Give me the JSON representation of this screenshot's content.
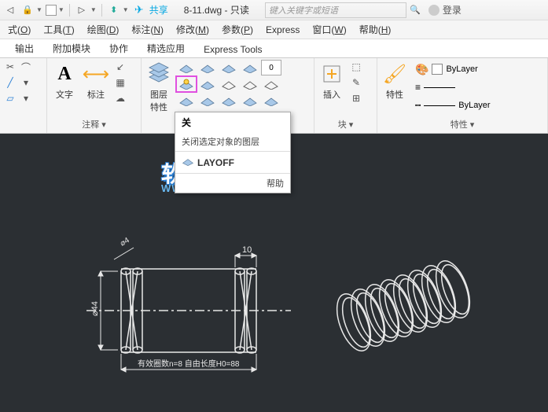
{
  "title": {
    "doc": "8-11.dwg - 只读"
  },
  "search": {
    "placeholder": "键入关键字或短语"
  },
  "login": {
    "label": "登录"
  },
  "share": {
    "label": "共享"
  },
  "menu": {
    "items": [
      {
        "l": "式",
        "u": "O"
      },
      {
        "l": "工具",
        "u": "T"
      },
      {
        "l": "绘图",
        "u": "D"
      },
      {
        "l": "标注",
        "u": "N"
      },
      {
        "l": "修改",
        "u": "M"
      },
      {
        "l": "参数",
        "u": "P"
      },
      {
        "l": "Express",
        "u": ""
      },
      {
        "l": "窗口",
        "u": "W"
      },
      {
        "l": "帮助",
        "u": "H"
      }
    ]
  },
  "tabs": {
    "items": [
      "输出",
      "附加模块",
      "协作",
      "精选应用",
      "Express Tools"
    ],
    "active": -1
  },
  "panels": {
    "annotate": {
      "text_lbl": "文字",
      "dim_lbl": "标注",
      "title": "注释 ▾"
    },
    "layer": {
      "big_lbl": "图层\n特性"
    },
    "block": {
      "insert_lbl": "插入",
      "title": "块 ▾"
    },
    "props": {
      "big_lbl": "特性",
      "bylayer": "ByLayer",
      "title": "特性 ▾"
    },
    "unlabeled_swatch": "0"
  },
  "tooltip": {
    "t1": "关",
    "t2": "关闭选定对象的图层",
    "t3": "LAYOFF",
    "t4": "帮助"
  },
  "watermark": {
    "line1": "软件自学网",
    "line2": "WWW.RJZXW.COM"
  },
  "drawing": {
    "dim_top": "10",
    "dim_left_diam": "⌀4",
    "dim_v": "⌀44",
    "note": "有效圈数n=8   自由长度H0=88"
  }
}
